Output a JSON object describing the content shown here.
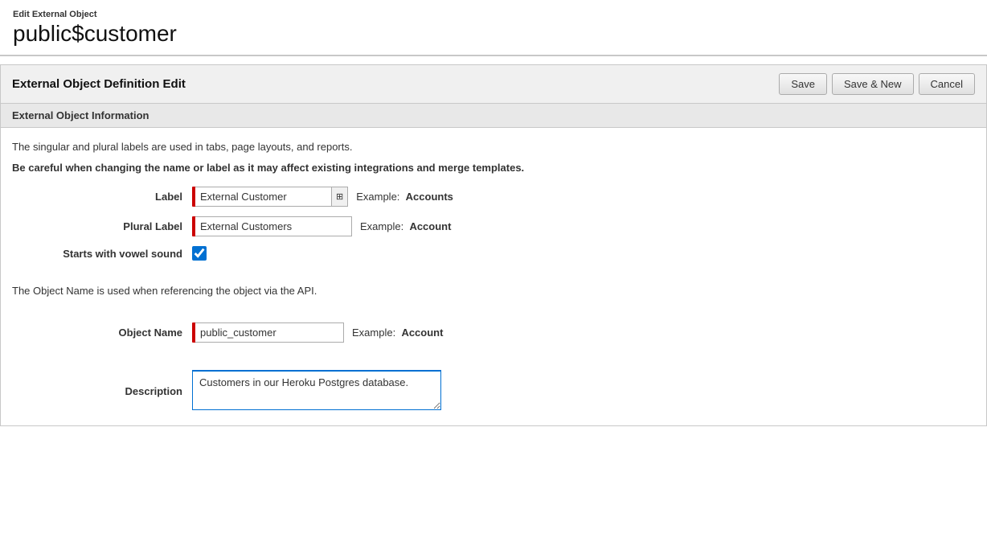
{
  "header": {
    "breadcrumb": "Edit External Object",
    "title": "public$customer"
  },
  "panel": {
    "title": "External Object Definition Edit",
    "save_button": "Save",
    "save_new_button": "Save & New",
    "cancel_button": "Cancel"
  },
  "section": {
    "title": "External Object Information",
    "info_line1": "The singular and plural labels are used in tabs, page layouts, and reports.",
    "info_line2": "Be careful when changing the name or label as it may affect existing integrations and merge templates.",
    "label_field": {
      "label": "Label",
      "value": "External Customer",
      "example_prefix": "Example:",
      "example_value": "Accounts"
    },
    "plural_label_field": {
      "label": "Plural Label",
      "value": "External Customers",
      "example_prefix": "Example:",
      "example_value": "Account"
    },
    "vowel_field": {
      "label": "Starts with vowel sound",
      "checked": true
    },
    "api_info": "The Object Name is used when referencing the object via the API.",
    "object_name_field": {
      "label": "Object Name",
      "value": "public_customer",
      "example_prefix": "Example:",
      "example_value": "Account"
    },
    "description_field": {
      "label": "Description",
      "value": "Customers in our Heroku Postgres database."
    }
  }
}
